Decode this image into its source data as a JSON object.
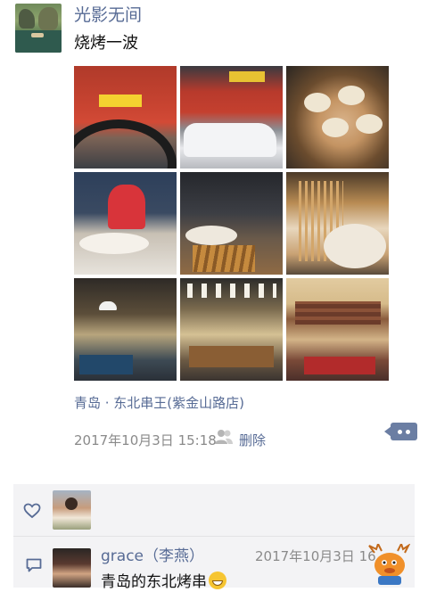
{
  "post": {
    "username": "光影无间",
    "text": "烧烤一波",
    "location": "青岛 · 东北串王(紫金山路店)",
    "time": "2017年10月3日 15:18",
    "delete_label": "删除"
  },
  "photos": [
    {
      "name": "photo-restaurant-front"
    },
    {
      "name": "photo-street-car"
    },
    {
      "name": "photo-grilled-scallops"
    },
    {
      "name": "photo-child-at-table"
    },
    {
      "name": "photo-child-skewers"
    },
    {
      "name": "photo-skewers-scallops"
    },
    {
      "name": "photo-interior-booths"
    },
    {
      "name": "photo-interior-dining"
    },
    {
      "name": "photo-interior-brick-wall"
    }
  ],
  "comments": [
    {
      "author": "grace（李燕）",
      "time": "2017年10月3日 16",
      "text": "青岛的东北烤串"
    }
  ],
  "colors": {
    "link": "#576b95",
    "panel_bg": "#f3f3f5",
    "meta_text": "#8a8a8a"
  },
  "icons": {
    "like": "heart-outline-icon",
    "comment": "comment-icon",
    "people": "people-icon",
    "more": "more-dots-icon",
    "emoji": "grinning-emoji-icon"
  }
}
